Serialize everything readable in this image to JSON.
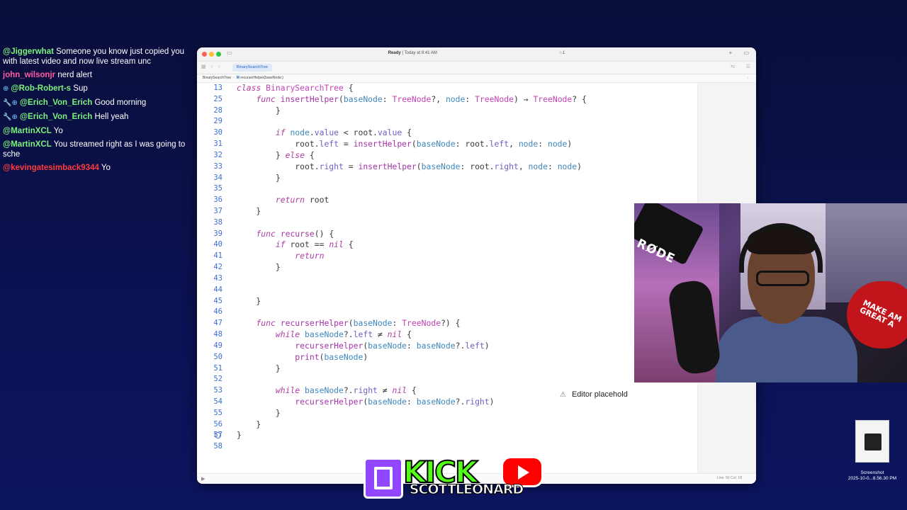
{
  "chat": {
    "messages": [
      {
        "user": "@Jiggerwhat",
        "user_color": "#7cf17c",
        "badges": "",
        "text": "Someone you know just copied you with latest video and now live stream unc"
      },
      {
        "user": "john_wilsonjr",
        "user_color": "#ff5ca0",
        "badges": "",
        "text": "nerd alert"
      },
      {
        "user": "@Rob-Robert-s",
        "user_color": "#7cf17c",
        "badges": "⊕",
        "text": "Sup"
      },
      {
        "user": "@Erich_Von_Erich",
        "user_color": "#7cf17c",
        "badges": "🔧⊕",
        "text": "Good morning"
      },
      {
        "user": "@Erich_Von_Erich",
        "user_color": "#7cf17c",
        "badges": "🔧⊕",
        "text": "Hell yeah"
      },
      {
        "user": "@MartinXCL",
        "user_color": "#7cf17c",
        "badges": "",
        "text": "Yo"
      },
      {
        "user": "@MartinXCL",
        "user_color": "#7cf17c",
        "badges": "",
        "text": "You streamed right as I was going to sche"
      },
      {
        "user": "@kevingatesimback9344",
        "user_color": "#ff3b3b",
        "badges": "",
        "text": "Yo"
      }
    ]
  },
  "xcode": {
    "status_label": "Ready",
    "status_time": "Today at 8:41 AM",
    "warning_count": "1",
    "tab_label": "BinarySearchTree",
    "jump_bar": [
      "BinarySearchTree",
      "recurserHelper(baseNode:)"
    ],
    "cursor_position": "Line: 50  Col: 18",
    "placeholder_hint": "Editor placehold",
    "code_lines": [
      {
        "num": "13",
        "text": "class BinarySearchTree {"
      },
      {
        "num": "25",
        "text": "    func insertHelper(baseNode: TreeNode?, node: TreeNode) → TreeNode? {"
      },
      {
        "num": "28",
        "text": "        }"
      },
      {
        "num": "29",
        "text": ""
      },
      {
        "num": "30",
        "text": "        if node.value < root.value {"
      },
      {
        "num": "31",
        "text": "            root.left = insertHelper(baseNode: root.left, node: node)"
      },
      {
        "num": "32",
        "text": "        } else {"
      },
      {
        "num": "33",
        "text": "            root.right = insertHelper(baseNode: root.right, node: node)"
      },
      {
        "num": "34",
        "text": "        }"
      },
      {
        "num": "35",
        "text": ""
      },
      {
        "num": "36",
        "text": "        return root"
      },
      {
        "num": "37",
        "text": "    }"
      },
      {
        "num": "38",
        "text": ""
      },
      {
        "num": "39",
        "text": "    func recurse() {"
      },
      {
        "num": "40",
        "text": "        if root == nil {"
      },
      {
        "num": "41",
        "text": "            return"
      },
      {
        "num": "42",
        "text": "        }"
      },
      {
        "num": "43",
        "text": ""
      },
      {
        "num": "44",
        "text": ""
      },
      {
        "num": "45",
        "text": "    }"
      },
      {
        "num": "46",
        "text": ""
      },
      {
        "num": "47",
        "text": "    func recurserHelper(baseNode: TreeNode?) {"
      },
      {
        "num": "48",
        "text": "        while baseNode?.left ≠ nil {"
      },
      {
        "num": "49",
        "text": "            recurserHelper(baseNode: baseNode?.left)"
      },
      {
        "num": "50",
        "text": "            print(baseNode)"
      },
      {
        "num": "51",
        "text": "        }"
      },
      {
        "num": "52",
        "text": ""
      },
      {
        "num": "53",
        "text": "        while baseNode?.right ≠ nil {"
      },
      {
        "num": "54",
        "text": "            recurserHelper(baseNode: baseNode?.right)"
      },
      {
        "num": "55",
        "text": "        }"
      },
      {
        "num": "56",
        "text": "    }"
      },
      {
        "num": "57",
        "text": "}"
      },
      {
        "num": "58",
        "text": ""
      }
    ]
  },
  "webcam": {
    "mic_brand": "RØDE",
    "hat_text": "MAKE AM GREAT A"
  },
  "overlay_logo": {
    "kick": "KICK",
    "name": "SCOTTLEONARD"
  },
  "desktop_icon": {
    "label_line1": "Screenshot",
    "label_line2": "2025-10-0...8.56.30 PM"
  },
  "colors": {
    "keyword": "#ad3da4",
    "type": "#c342b6",
    "line_number": "#3a6fd6",
    "twitch": "#9146ff",
    "kick": "#53fc18",
    "youtube": "#ff0000"
  }
}
